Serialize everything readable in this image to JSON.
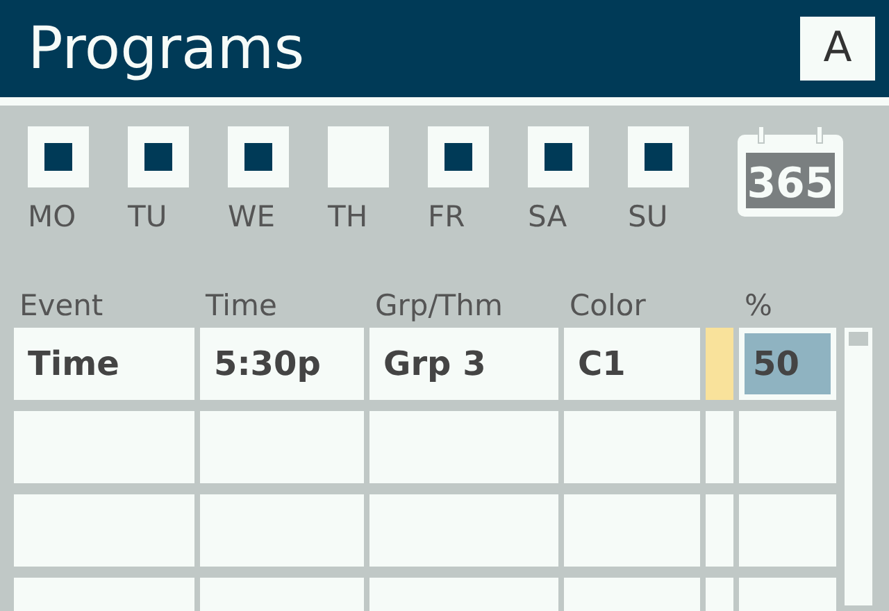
{
  "header": {
    "title": "Programs",
    "button": "A"
  },
  "days": [
    {
      "label": "MO",
      "checked": true
    },
    {
      "label": "TU",
      "checked": true
    },
    {
      "label": "WE",
      "checked": true
    },
    {
      "label": "TH",
      "checked": false
    },
    {
      "label": "FR",
      "checked": true
    },
    {
      "label": "SA",
      "checked": true
    },
    {
      "label": "SU",
      "checked": true
    }
  ],
  "calendar_icon": {
    "label": "365"
  },
  "table": {
    "columns": [
      "Event",
      "Time",
      "Grp/Thm",
      "Color",
      "%"
    ],
    "rows": [
      {
        "event": "Time",
        "time": "5:30p",
        "group": "Grp 3",
        "color_name": "C1",
        "color": "#f9e29b",
        "percent": "50",
        "percent_selected": true
      }
    ]
  }
}
